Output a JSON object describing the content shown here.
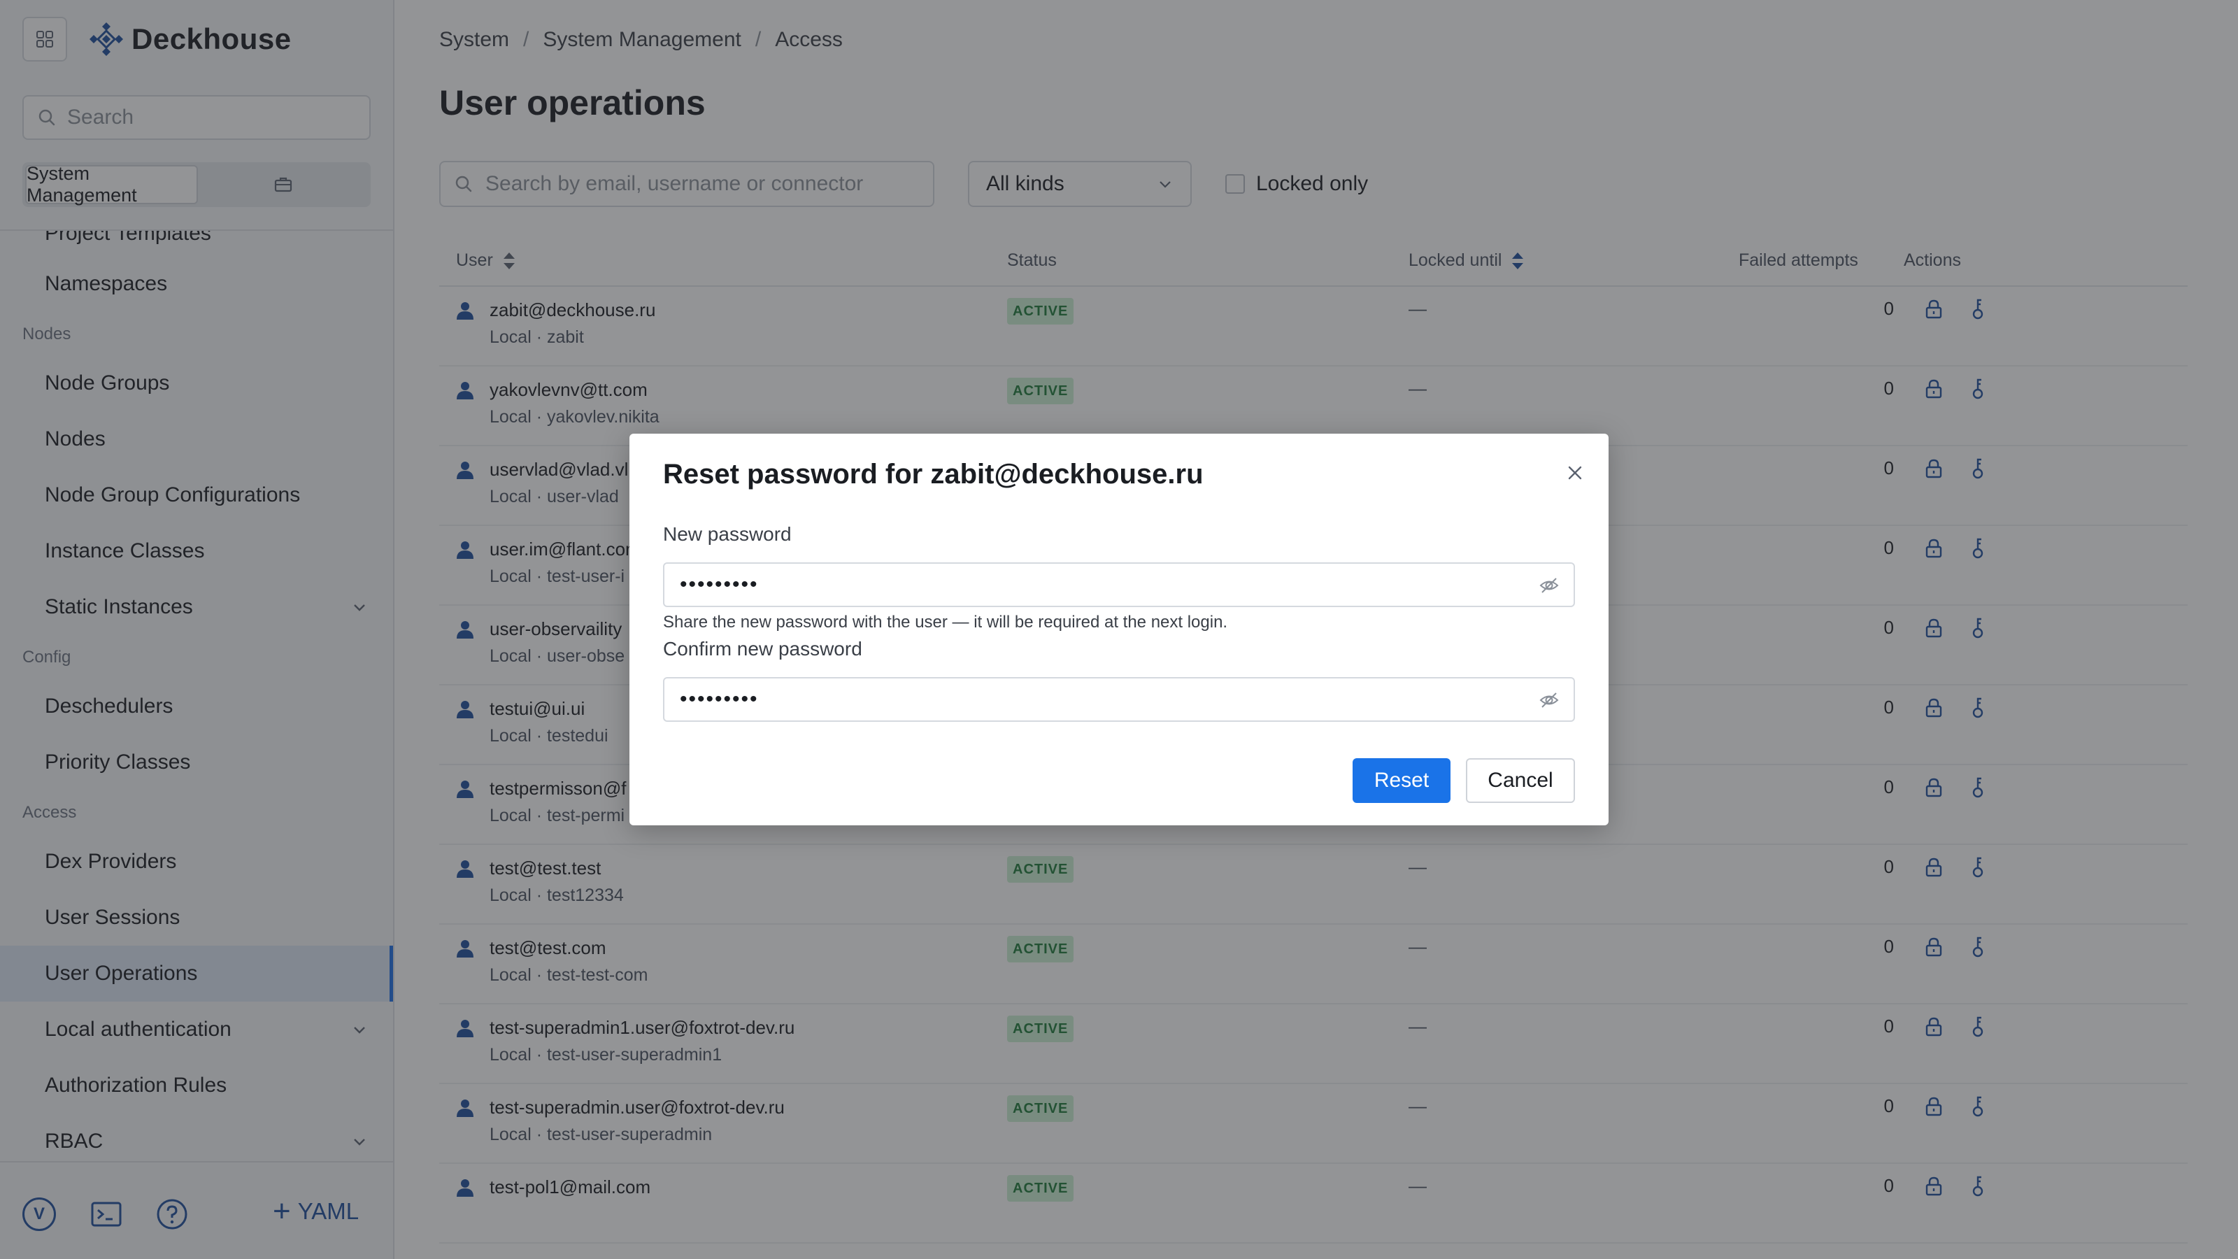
{
  "app": {
    "name": "Deckhouse",
    "search_placeholder": "Search"
  },
  "segment": {
    "active": "System Management"
  },
  "nav": {
    "items": [
      {
        "label": "Project Templates"
      },
      {
        "label": "Namespaces"
      },
      {
        "section": "Nodes"
      },
      {
        "label": "Node Groups"
      },
      {
        "label": "Nodes"
      },
      {
        "label": "Node Group Configurations"
      },
      {
        "label": "Instance Classes"
      },
      {
        "label": "Static Instances"
      },
      {
        "section": "Config"
      },
      {
        "label": "Deschedulers"
      },
      {
        "label": "Priority Classes"
      },
      {
        "section": "Access"
      },
      {
        "label": "Dex Providers"
      },
      {
        "label": "User Sessions"
      },
      {
        "label": "User Operations"
      },
      {
        "label": "Local authentication"
      },
      {
        "label": "Authorization Rules"
      },
      {
        "label": "RBAC"
      }
    ]
  },
  "bottom_bar": {
    "version_badge": "V",
    "yaml_label": "YAML"
  },
  "breadcrumb": [
    "System",
    "System Management",
    "Access"
  ],
  "page": {
    "title": "User operations"
  },
  "filters": {
    "search_placeholder": "Search by email, username or connector",
    "kind_value": "All kinds",
    "locked_only_label": "Locked only"
  },
  "table": {
    "columns": [
      "User",
      "Status",
      "Locked until",
      "Failed attempts",
      "Actions"
    ],
    "rows": [
      {
        "email": "zabit@deckhouse.ru",
        "sub": "Local · zabit",
        "status": "ACTIVE",
        "locked": "—",
        "failed": "0"
      },
      {
        "email": "yakovlevnv@tt.com",
        "sub": "Local · yakovlev.nikita",
        "status": "ACTIVE",
        "locked": "—",
        "failed": "0"
      },
      {
        "email": "uservlad@vlad.vl",
        "sub": "Local · user-vlad",
        "status": "",
        "locked": "",
        "failed": "0"
      },
      {
        "email": "user.im@flant.com",
        "sub": "Local · test-user-i",
        "status": "",
        "locked": "",
        "failed": "0"
      },
      {
        "email": "user-observaility",
        "sub": "Local · user-obse",
        "status": "",
        "locked": "",
        "failed": "0"
      },
      {
        "email": "testui@ui.ui",
        "sub": "Local · testedui",
        "status": "",
        "locked": "",
        "failed": "0"
      },
      {
        "email": "testpermisson@f",
        "sub": "Local · test-permi",
        "status": "",
        "locked": "",
        "failed": "0"
      },
      {
        "email": "test@test.test",
        "sub": "Local · test12334",
        "status": "ACTIVE",
        "locked": "—",
        "failed": "0"
      },
      {
        "email": "test@test.com",
        "sub": "Local · test-test-com",
        "status": "ACTIVE",
        "locked": "—",
        "failed": "0"
      },
      {
        "email": "test-superadmin1.user@foxtrot-dev.ru",
        "sub": "Local · test-user-superadmin1",
        "status": "ACTIVE",
        "locked": "—",
        "failed": "0"
      },
      {
        "email": "test-superadmin.user@foxtrot-dev.ru",
        "sub": "Local · test-user-superadmin",
        "status": "ACTIVE",
        "locked": "—",
        "failed": "0"
      },
      {
        "email": "test-pol1@mail.com",
        "sub": "",
        "status": "ACTIVE",
        "locked": "—",
        "failed": "0"
      }
    ]
  },
  "modal": {
    "title": "Reset password for zabit@deckhouse.ru",
    "new_password_label": "New password",
    "new_password_value": "•••••••••",
    "hint": "Share the new password with the user — it will be required at the next login.",
    "confirm_label": "Confirm new password",
    "confirm_value": "•••••••••",
    "reset_label": "Reset",
    "cancel_label": "Cancel"
  },
  "colors": {
    "accent": "#1a73e8",
    "brand": "#1f4e9c",
    "active_badge_bg": "#cbeed2",
    "active_badge_fg": "#1f7a3a"
  }
}
